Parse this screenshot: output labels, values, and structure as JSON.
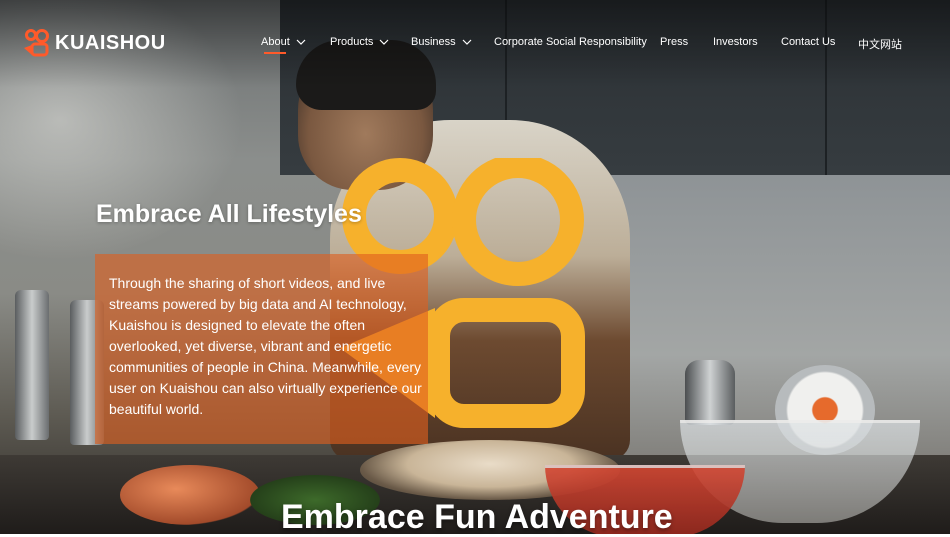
{
  "brand": {
    "name": "KUAISHOU",
    "logo_icon": "kuaishou-logo-icon",
    "accent_color": "#ff5a2a"
  },
  "nav": {
    "items": [
      {
        "label": "About",
        "has_dropdown": true,
        "active": true
      },
      {
        "label": "Products",
        "has_dropdown": true
      },
      {
        "label": "Business",
        "has_dropdown": true
      },
      {
        "label": "Corporate Social Responsibility"
      },
      {
        "label": "Press"
      },
      {
        "label": "Investors"
      },
      {
        "label": "Contact Us"
      },
      {
        "label": "中文网站"
      }
    ]
  },
  "hero": {
    "title": "Embrace All Lifestyles",
    "description": "Through the sharing of short videos, and live streams powered by big data and AI technology, Kuaishou is designed to elevate the often overlooked, yet diverse, vibrant and energetic communities of people in China. Meanwhile, every user on Kuaishou can also virtually experience our beautiful world.",
    "box_color": "#de5f1e",
    "overlay_logo_color": "#f6b12c"
  },
  "next_section": {
    "title": "Embrace Fun Adventure"
  }
}
